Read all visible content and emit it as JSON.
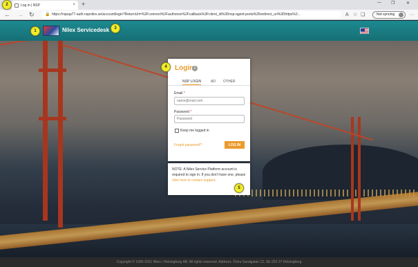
{
  "browser": {
    "tab_title": "Log in | NSP",
    "tab_close": "×",
    "new_tab": "+",
    "url": "https://nspqa77-auth.nspnilex.se/account/login?ReturnUrl=%2Fconnect%2Fauthorize%2Fcallback%3Fclient_id%3Dnsp-agent-porta%26redirect_uri%3Dhttps%2...",
    "sync_label": "Not syncing",
    "more": "···",
    "minimize": "—",
    "restore": "❐",
    "close": "✕"
  },
  "header": {
    "brand": "Nilex Servicedesk"
  },
  "login": {
    "title": "Login",
    "info_glyph": "i",
    "tabs": [
      "NSP LOGIN",
      "AD",
      "OTHER"
    ],
    "email_label": "Email",
    "email_placeholder": "name@mail.com",
    "password_label": "Password",
    "password_placeholder": "Password",
    "required_mark": "*",
    "keep_logged_in": "Keep me logged in",
    "forgot": "Forgot password?",
    "login_button": "LOG IN"
  },
  "note": {
    "text": "NOTE: A Nilex Service Platform account is required to sign in. If you don't have one, please ",
    "link": "click here to contact support",
    "end": "."
  },
  "footer": {
    "text": "Copyright © 1996-2021 Nilex i Helsingborg AB. All rights reserved. Address: Östra Sandgatan 12, SE-252 27 Helsingborg"
  },
  "badges": [
    "1",
    "2",
    "3",
    "4",
    "5"
  ],
  "colors": {
    "accent": "#e89a2b",
    "header": "#1d8a90",
    "badge": "#f2ec2a"
  }
}
